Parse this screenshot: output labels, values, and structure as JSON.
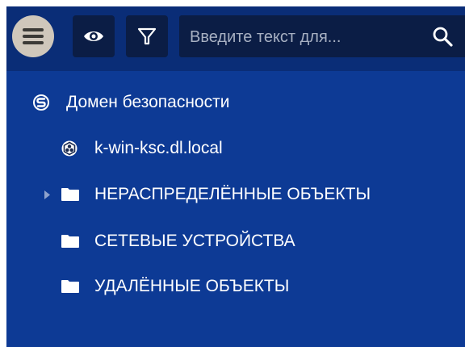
{
  "toolbar": {
    "menu_icon": "hamburger-menu-icon",
    "view_icon": "eye-icon",
    "filter_icon": "filter-funnel-icon",
    "search": {
      "placeholder": "Введите текст для...",
      "value": "",
      "icon": "search-icon"
    }
  },
  "tree": {
    "root": {
      "label": "Домен безопасности",
      "icon": "security-domain-icon"
    },
    "items": [
      {
        "label": "k-win-ksc.dl.local",
        "icon": "server-node-icon",
        "expandable": false
      },
      {
        "label": "НЕРАСПРЕДЕЛЁННЫЕ ОБЪЕКТЫ",
        "icon": "folder-icon",
        "expandable": true
      },
      {
        "label": "СЕТЕВЫЕ УСТРОЙСТВА",
        "icon": "folder-icon",
        "expandable": false
      },
      {
        "label": "УДАЛЁННЫЕ ОБЪЕКТЫ",
        "icon": "folder-icon",
        "expandable": false
      }
    ]
  },
  "colors": {
    "panel_background": "#0d3a95",
    "toolbar_background": "#0a2d77",
    "button_background": "#0b1d45",
    "menu_button": "#cfc7bb",
    "text": "#ffffff"
  }
}
